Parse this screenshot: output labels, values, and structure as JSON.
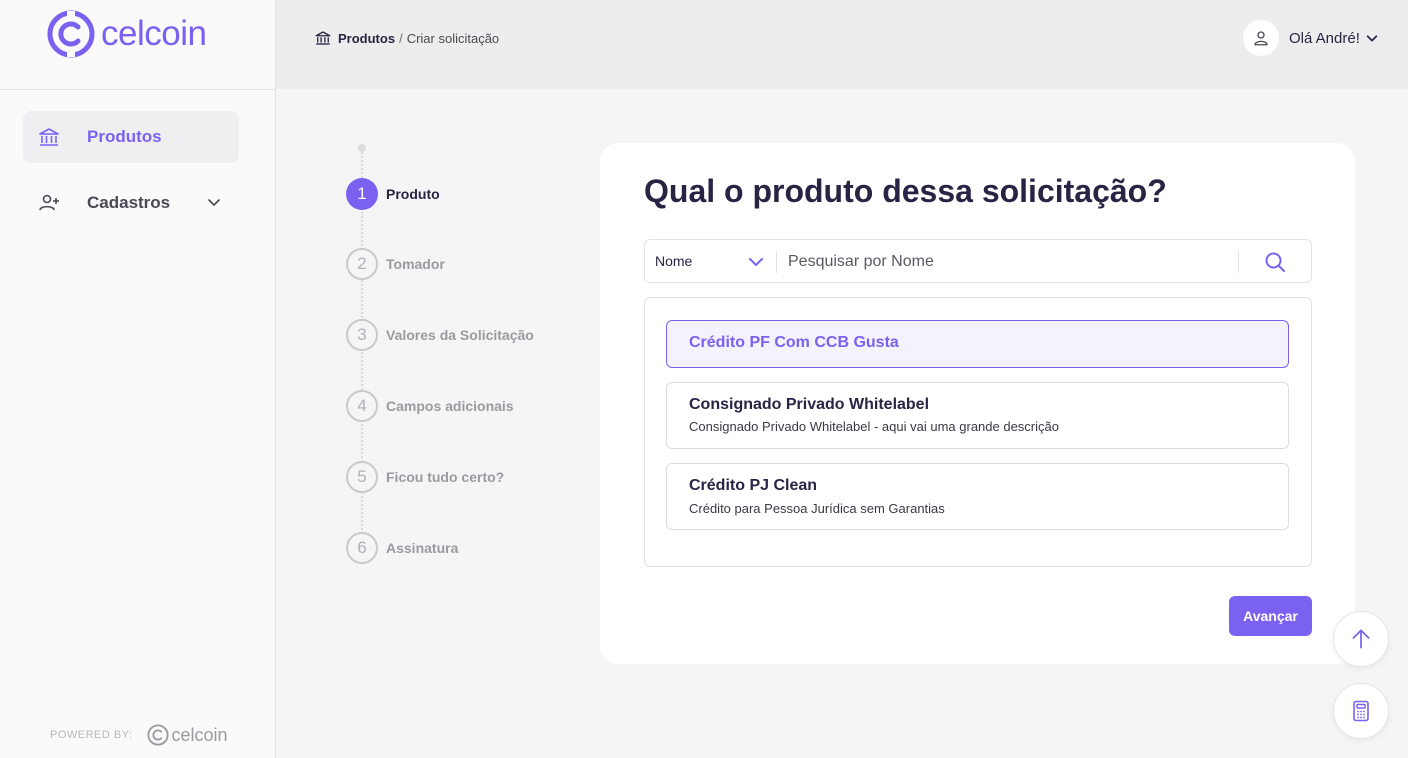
{
  "brand": {
    "name": "celcoin",
    "accent": "#7b61ef"
  },
  "sidebar": {
    "items": [
      {
        "label": "Produtos",
        "icon": "bank-icon",
        "active": true
      },
      {
        "label": "Cadastros",
        "icon": "user-add-icon",
        "active": false,
        "expandable": true
      }
    ],
    "powered_by": "POWERED BY:",
    "powered_brand": "celcoin"
  },
  "header": {
    "breadcrumb": {
      "root": "Produtos",
      "separator": "/",
      "current": "Criar solicitação"
    },
    "greeting": "Olá André!"
  },
  "stepper": {
    "steps": [
      {
        "number": "1",
        "label": "Produto",
        "state": "active"
      },
      {
        "number": "2",
        "label": "Tomador",
        "state": "pending"
      },
      {
        "number": "3",
        "label": "Valores da Solicitação",
        "state": "pending"
      },
      {
        "number": "4",
        "label": "Campos adicionais",
        "state": "pending"
      },
      {
        "number": "5",
        "label": "Ficou tudo certo?",
        "state": "pending"
      },
      {
        "number": "6",
        "label": "Assinatura",
        "state": "pending"
      }
    ]
  },
  "main": {
    "title_prefix": "Qual o ",
    "title_bold": "produto",
    "title_suffix": " dessa solicitação?",
    "search": {
      "filter_value": "Nome",
      "placeholder": "Pesquisar por Nome",
      "value": ""
    },
    "products": [
      {
        "title": "Crédito PF Com CCB Gusta",
        "description": "",
        "selected": true
      },
      {
        "title": "Consignado Privado Whitelabel",
        "description": "Consignado Privado Whitelabel - aqui vai uma grande descrição",
        "selected": false
      },
      {
        "title": "Crédito PJ Clean",
        "description": "Crédito para Pessoa Jurídica sem Garantias",
        "selected": false
      }
    ],
    "next_label": "Avançar"
  },
  "fabs": {
    "scroll_top": "arrow-up-icon",
    "calculator": "calculator-icon"
  }
}
